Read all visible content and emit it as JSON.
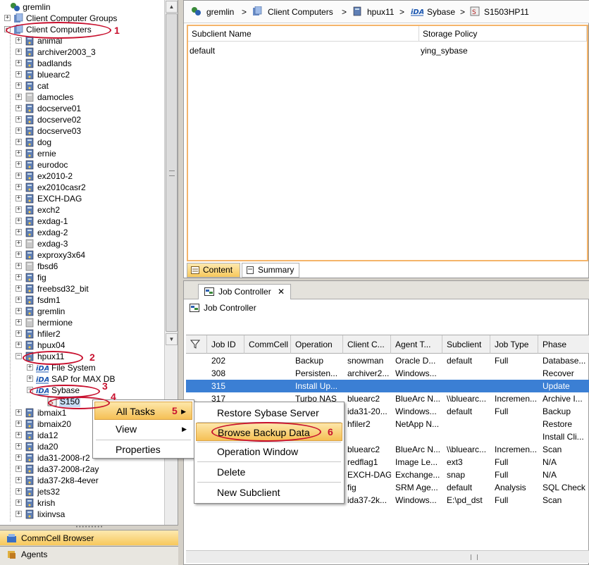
{
  "tree": {
    "root": "gremlin",
    "client_computer_groups": "Client Computer Groups",
    "client_computers": "Client Computers",
    "clients": [
      "animal",
      "archiver2003_3",
      "badlands",
      "bluearc2",
      "cat",
      "damocles",
      "docserve01",
      "docserve02",
      "docserve03",
      "dog",
      "ernie",
      "eurodoc",
      "ex2010-2",
      "ex2010casr2",
      "EXCH-DAG",
      "exch2",
      "exdag-1",
      "exdag-2",
      "exdag-3",
      "exproxy3x64",
      "fbsd6",
      "fig",
      "freebsd32_bit",
      "fsdm1",
      "gremlin",
      "hermione",
      "hfiler2",
      "hpux04",
      "hpux11"
    ],
    "hpux11_children": [
      "File System",
      "SAP for MAX DB",
      "Sybase"
    ],
    "sybase_child": "S150",
    "clients_after": [
      "ibmaix1",
      "ibmaix20",
      "ida12",
      "ida20",
      "ida31-2008-r2",
      "ida37-2008-r2ay",
      "ida37-2k8-4ever",
      "jets32",
      "krish",
      "lixinvsa"
    ]
  },
  "nav": {
    "commcell_browser": "CommCell Browser",
    "agents": "Agents"
  },
  "breadcrumb": [
    "gremlin",
    "Client Computers",
    "hpux11",
    "Sybase",
    "S1503HP11"
  ],
  "subclient_table": {
    "columns": [
      "Subclient Name",
      "Storage Policy"
    ],
    "rows": [
      [
        "default",
        "ying_sybase"
      ]
    ]
  },
  "top_tabs": [
    "Content",
    "Summary"
  ],
  "job_controller": {
    "tab_label": "Job Controller",
    "close_label": "✕",
    "title": "Job Controller",
    "columns": [
      "Job ID",
      "CommCell",
      "Operation",
      "Client C...",
      "Agent T...",
      "Subclient",
      "Job Type",
      "Phase"
    ],
    "rows": [
      [
        "202",
        "",
        "Backup",
        "snowman",
        "Oracle D...",
        "default",
        "Full",
        "Database..."
      ],
      [
        "308",
        "",
        "Persisten...",
        "archiver2...",
        "Windows...",
        "",
        "",
        "Recover"
      ],
      [
        "315",
        "",
        "Install Up...",
        "",
        "",
        "",
        "",
        "Update"
      ],
      [
        "317",
        "",
        "Turbo NAS",
        "bluearc2",
        "BlueArc N...",
        "\\\\bluearc...",
        "Incremen...",
        "Archive I..."
      ],
      [
        "",
        "",
        "",
        "ida31-20...",
        "Windows...",
        "default",
        "Full",
        "Backup"
      ],
      [
        "",
        "",
        "",
        "hfiler2",
        "NetApp N...",
        "",
        "",
        "Restore"
      ],
      [
        "",
        "",
        "",
        "",
        "",
        "",
        "",
        "Install Cli..."
      ],
      [
        "",
        "",
        "",
        "bluearc2",
        "BlueArc N...",
        "\\\\bluearc...",
        "Incremen...",
        "Scan"
      ],
      [
        "",
        "",
        "",
        "redflag1",
        "Image Le...",
        "ext3",
        "Full",
        "N/A"
      ],
      [
        "",
        "",
        "",
        "EXCH-DAG",
        "Exchange...",
        "snap",
        "Full",
        "N/A"
      ],
      [
        "",
        "",
        "",
        "fig",
        "SRM Age...",
        "default",
        "Analysis",
        "SQL Check"
      ],
      [
        "",
        "",
        "",
        "ida37-2k...",
        "Windows...",
        "E:\\pd_dst",
        "Full",
        "Scan"
      ]
    ],
    "selected_row": 2
  },
  "context_menu": {
    "items": [
      "All Tasks",
      "View",
      "Properties"
    ],
    "submenu": [
      "Restore Sybase Server",
      "Browse Backup Data",
      "Operation Window",
      "Delete",
      "New Subclient"
    ]
  },
  "annotations": [
    "1",
    "2",
    "3",
    "4",
    "5",
    "6"
  ],
  "colors": {
    "selection": "#3b7fd4",
    "annotation": "#c8102e",
    "menu_highlight": "#f5c055",
    "panel_border": "#f4b46a"
  }
}
